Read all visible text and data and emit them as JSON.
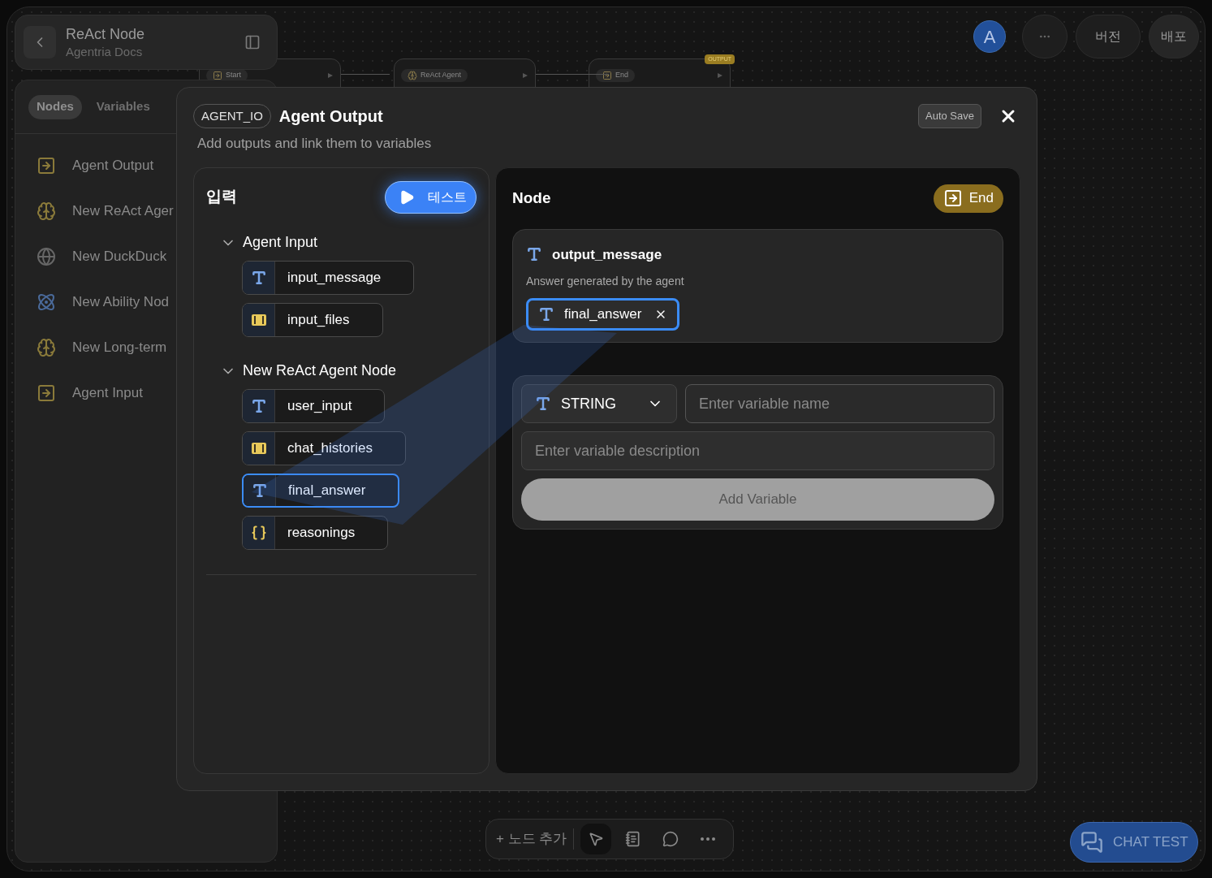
{
  "header": {
    "title": "ReAct Node",
    "subtitle": "Agentria Docs"
  },
  "sidebar": {
    "tabs": [
      {
        "label": "Nodes",
        "selected": true
      },
      {
        "label": "Variables",
        "selected": false
      }
    ],
    "items": [
      {
        "label": "Agent Output",
        "kind": "io"
      },
      {
        "label": "New ReAct Ager",
        "kind": "brain"
      },
      {
        "label": "New DuckDuck",
        "kind": "globe"
      },
      {
        "label": "New Ability Nod",
        "kind": "atom"
      },
      {
        "label": "New Long-term",
        "kind": "brain"
      },
      {
        "label": "Agent Input",
        "kind": "io"
      }
    ]
  },
  "canvas_nodes": [
    {
      "label": "Start",
      "kind": "start"
    },
    {
      "label": "ReAct Agent",
      "kind": "brain"
    },
    {
      "label": "End",
      "kind": "io",
      "badge": "OUTPUT"
    }
  ],
  "topbar": {
    "avatar": "A",
    "buttons": [
      "버전",
      "배포"
    ]
  },
  "modal": {
    "tag": "AGENT_IO",
    "title": "Agent Output",
    "subtitle": "Add outputs and link them to variables",
    "auto_save": "Auto Save",
    "input_panel": {
      "title": "입력",
      "test_button": "테스트",
      "groups": [
        {
          "name": "Agent Input",
          "expanded": true,
          "variables": [
            {
              "name": "input_message",
              "kind": "string",
              "selected": false
            },
            {
              "name": "input_files",
              "kind": "array",
              "selected": false
            }
          ]
        },
        {
          "name": "New ReAct Agent Node",
          "expanded": true,
          "variables": [
            {
              "name": "user_input",
              "kind": "string",
              "selected": false
            },
            {
              "name": "chat_histories",
              "kind": "array",
              "selected": false
            },
            {
              "name": "final_answer",
              "kind": "string",
              "selected": true
            },
            {
              "name": "reasonings",
              "kind": "object",
              "selected": false
            }
          ]
        }
      ]
    },
    "node_panel": {
      "title": "Node",
      "end_badge": "End",
      "output": {
        "name": "output_message",
        "description": "Answer generated by the agent",
        "linked": "final_answer"
      },
      "form": {
        "type": "STRING",
        "name_placeholder": "Enter variable name",
        "description_placeholder": "Enter variable description",
        "add_button": "Add Variable",
        "add_disabled": true
      }
    }
  },
  "toolbar": {
    "add_label": "+ 노드 추가",
    "tools": [
      {
        "kind": "pointer",
        "selected": true
      },
      {
        "kind": "note",
        "selected": false
      },
      {
        "kind": "comment",
        "selected": false
      },
      {
        "kind": "more",
        "selected": false
      }
    ]
  },
  "chat_test": "CHAT TEST"
}
